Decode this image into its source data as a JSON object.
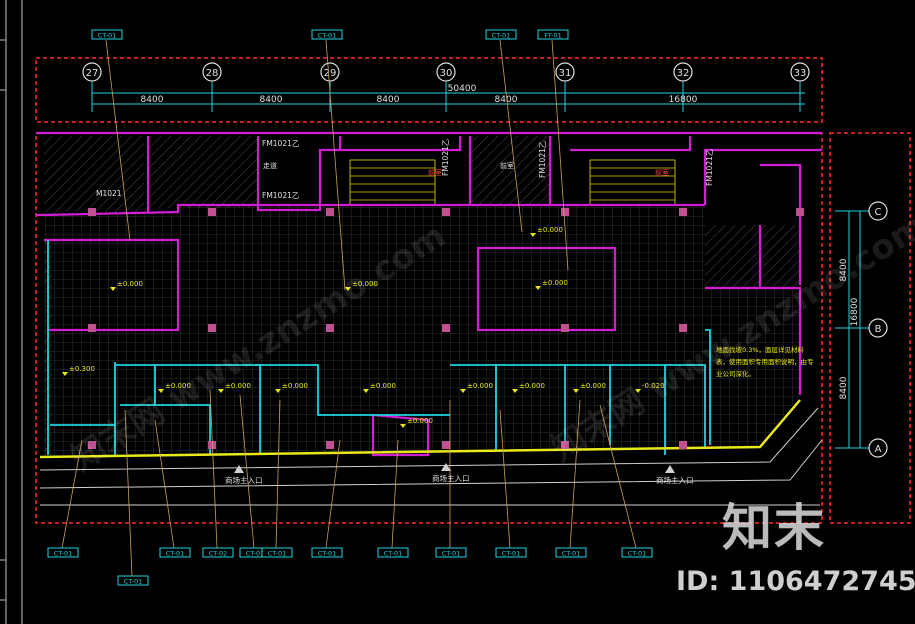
{
  "colors": {
    "background": "#000000",
    "border_red": "#ff2a2a",
    "wall_magenta": "#d21ed2",
    "partition_cyan": "#1fd3e0",
    "floor_yellow": "#e8e81a",
    "dimension_white": "#d8d8d8",
    "grid_fill": "#2a2a2a",
    "leader_tan": "#c8a060",
    "column_pink": "#c05090"
  },
  "axes_top": [
    "27",
    "28",
    "29",
    "30",
    "31",
    "32",
    "33"
  ],
  "axes_right": [
    "C",
    "B",
    "A"
  ],
  "dimensions_top": [
    "8400",
    "8400",
    "8400",
    "8400",
    "16800"
  ],
  "dimension_overall": "50400",
  "dimensions_right": [
    "8400",
    "8400"
  ],
  "dimension_right_overall": "16800",
  "door_tags": [
    "M1021",
    "FM1021乙",
    "FM1021乙",
    "FM1021乙",
    "FM1021乙",
    "FM1021乙"
  ],
  "room_labels": [
    "走道",
    "前室",
    "前室",
    "前室"
  ],
  "elevations": [
    "±0.000",
    "±0.000",
    "±0.000",
    "±0.000",
    "±0.300",
    "±0.000",
    "±0.000",
    "±0.000",
    "±0.000",
    "±0.000",
    "±0.000",
    "±0.000",
    "±0.000",
    "-0.020"
  ],
  "callout_tags": [
    "CT-01",
    "CT-01",
    "CT-01",
    "FT-01",
    "CT-01",
    "CT-01",
    "CT-01",
    "CT-02",
    "CT-01",
    "CT-01",
    "CT-01",
    "CT-01",
    "CT-01",
    "CT-01",
    "CT-01",
    "CT-01"
  ],
  "entrances": [
    "商场主入口",
    "商场主入口",
    "商场主入口"
  ],
  "note": "地面找坡0.3%，面层详见材料表，使用面积专用面积说明，由专业公司深化。",
  "watermark": {
    "logo_text": "知末",
    "id_text": "ID: 1106472745",
    "site_text": "知末网 www.znzmo.com"
  }
}
